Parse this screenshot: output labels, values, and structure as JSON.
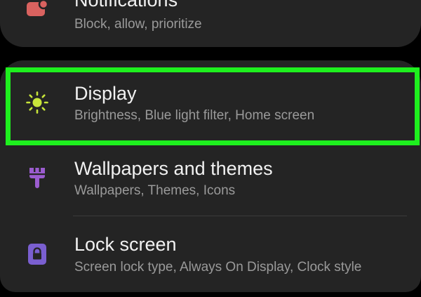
{
  "settings": {
    "items": [
      {
        "title": "Notifications",
        "subtitle": "Block, allow, prioritize",
        "icon": "notifications-icon"
      },
      {
        "title": "Display",
        "subtitle": "Brightness, Blue light filter, Home screen",
        "icon": "sun-icon"
      },
      {
        "title": "Wallpapers and themes",
        "subtitle": "Wallpapers, Themes, Icons",
        "icon": "paintbrush-icon"
      },
      {
        "title": "Lock screen",
        "subtitle": "Screen lock type, Always On Display, Clock style",
        "icon": "lock-icon"
      }
    ]
  },
  "colors": {
    "highlight": "#1ef01e",
    "notifications_icon": "#d9625f",
    "display_icon": "#c8e63a",
    "wallpapers_icon": "#9b5ccf",
    "lock_icon": "#7a5fd0"
  }
}
